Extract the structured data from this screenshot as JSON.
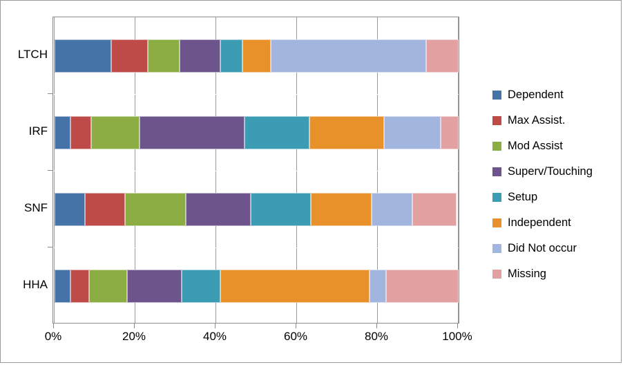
{
  "chart_data": {
    "type": "bar",
    "orientation": "horizontal",
    "stacked": true,
    "normalized_percent": true,
    "title": "",
    "xlabel": "",
    "ylabel": "",
    "xlim": [
      0,
      100
    ],
    "xticks": [
      "0%",
      "20%",
      "40%",
      "60%",
      "80%",
      "100%"
    ],
    "xtick_values": [
      0,
      20,
      40,
      60,
      80,
      100
    ],
    "grid": true,
    "legend_position": "right",
    "categories": [
      "LTCH",
      "IRF",
      "SNF",
      "HHA"
    ],
    "category_order_top_to_bottom": [
      "LTCH",
      "IRF",
      "SNF",
      "HHA"
    ],
    "series": [
      {
        "name": "Dependent",
        "color": "#4572A7",
        "values": [
          14.0,
          4.0,
          7.5,
          4.0
        ]
      },
      {
        "name": "Max Assist.",
        "color": "#BE4B48",
        "values": [
          9.0,
          5.0,
          10.0,
          4.5
        ]
      },
      {
        "name": "Mod Assist",
        "color": "#8BAD44",
        "values": [
          8.0,
          12.0,
          15.0,
          9.5
        ]
      },
      {
        "name": "Superv/Touching",
        "color": "#6E548D",
        "values": [
          10.0,
          26.0,
          16.0,
          13.5
        ]
      },
      {
        "name": "Setup",
        "color": "#3C9CB4",
        "values": [
          5.5,
          16.0,
          15.0,
          9.5
        ]
      },
      {
        "name": "Independent",
        "color": "#E8912B",
        "values": [
          7.0,
          18.5,
          15.0,
          37.0
        ]
      },
      {
        "name": "Did Not occur",
        "color": "#A2B5DE",
        "values": [
          38.5,
          14.0,
          10.0,
          4.0
        ]
      },
      {
        "name": "Missing",
        "color": "#E2A0A0",
        "values": [
          8.0,
          4.5,
          11.0,
          18.0
        ]
      }
    ]
  },
  "legend": {
    "items": [
      {
        "label": "Dependent"
      },
      {
        "label": "Max Assist."
      },
      {
        "label": "Mod Assist"
      },
      {
        "label": "Superv/Touching"
      },
      {
        "label": "Setup"
      },
      {
        "label": "Independent"
      },
      {
        "label": "Did Not occur"
      },
      {
        "label": "Missing"
      }
    ]
  },
  "axes": {
    "x": {
      "ticks": [
        "0%",
        "20%",
        "40%",
        "60%",
        "80%",
        "100%"
      ]
    },
    "y": {
      "ticks": [
        "LTCH",
        "IRF",
        "SNF",
        "HHA"
      ]
    }
  }
}
